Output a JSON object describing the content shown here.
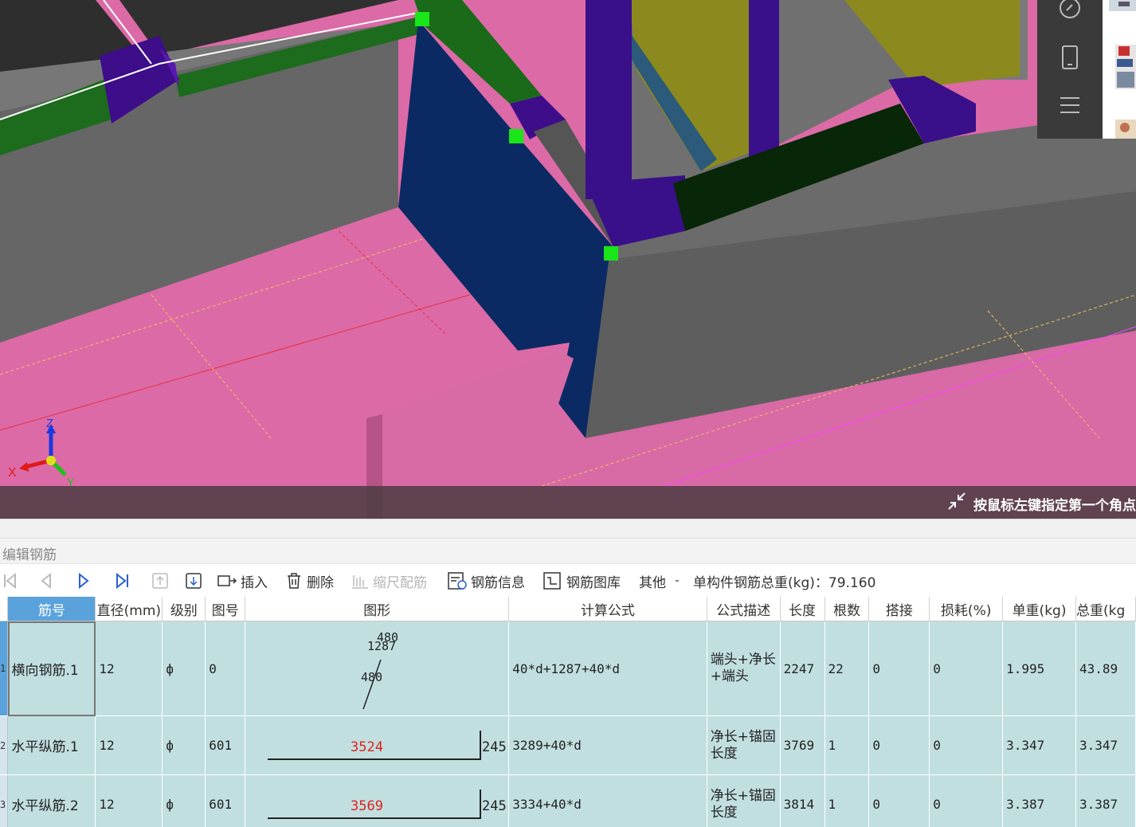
{
  "status": {
    "hint_text": "按鼠标左键指定第一个角点"
  },
  "viewport": {
    "axes": {
      "x": "X",
      "y": "Y",
      "z": "Z"
    },
    "side_toolbar": {
      "icons": [
        "link-icon",
        "phone-icon",
        "menu-icon"
      ]
    }
  },
  "panel": {
    "title": "编辑钢筋"
  },
  "toolbar": {
    "insert": "插入",
    "delete": "删除",
    "scale_rebar": "缩尺配筋",
    "rebar_info": "钢筋信息",
    "rebar_library": "钢筋图库",
    "other": "其他",
    "total_weight": "单构件钢筋总重(kg)：79.160"
  },
  "table": {
    "headers": [
      "筋号",
      "直径(mm)",
      "级别",
      "图号",
      "图形",
      "计算公式",
      "公式描述",
      "长度",
      "根数",
      "搭接",
      "损耗(%)",
      "单重(kg)",
      "总重(kg"
    ],
    "rows": [
      {
        "num": "1",
        "name": "横向钢筋.1",
        "diameter": "12",
        "grade": "ф",
        "fig_no": "0",
        "shape": {
          "labels": [
            "480",
            "1287",
            "480"
          ]
        },
        "formula": "40*d+1287+40*d",
        "desc": "端头+净长+端头",
        "length": "2247",
        "count": "22",
        "lap": "0",
        "loss": "0",
        "unit_weight": "1.995",
        "total_weight": "43.89"
      },
      {
        "num": "2",
        "name": "水平纵筋.1",
        "diameter": "12",
        "grade": "ф",
        "fig_no": "601",
        "shape": {
          "main": "3524",
          "hook": "245"
        },
        "formula": "3289+40*d",
        "desc": "净长+锚固长度",
        "length": "3769",
        "count": "1",
        "lap": "0",
        "loss": "0",
        "unit_weight": "3.347",
        "total_weight": "3.347"
      },
      {
        "num": "3",
        "name": "水平纵筋.2",
        "diameter": "12",
        "grade": "ф",
        "fig_no": "601",
        "shape": {
          "main": "3569",
          "hook": "245"
        },
        "formula": "3334+40*d",
        "desc": "净长+锚固长度",
        "length": "3814",
        "count": "1",
        "lap": "0",
        "loss": "0",
        "unit_weight": "3.387",
        "total_weight": "3.387"
      }
    ]
  }
}
